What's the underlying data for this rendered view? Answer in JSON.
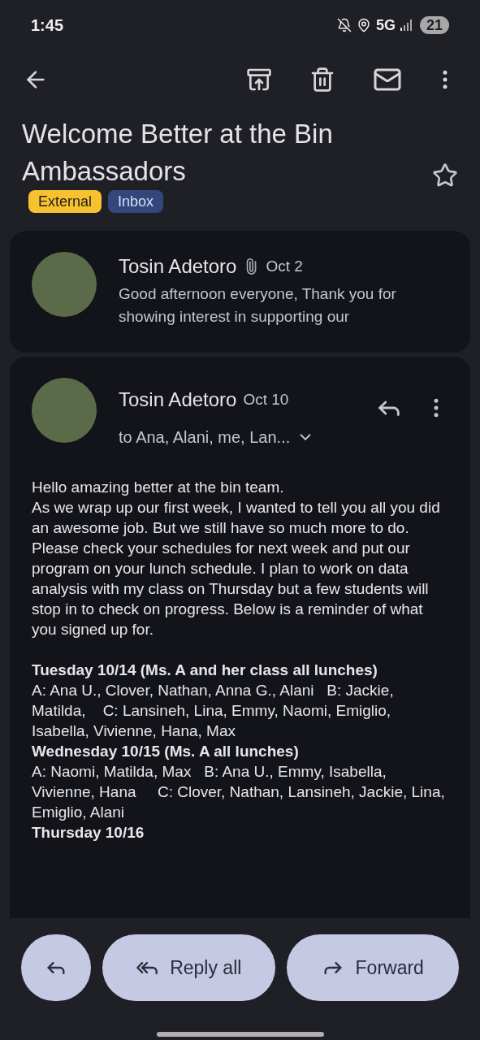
{
  "status_bar": {
    "time": "1:45",
    "network": "5G",
    "battery": "21"
  },
  "subject": {
    "title": "Welcome Better at the Bin Ambassadors",
    "labels": [
      {
        "text": "External",
        "color": "#f8c12f"
      },
      {
        "text": "Inbox",
        "color": "#34477c"
      }
    ],
    "starred": false
  },
  "messages": [
    {
      "sender": "Tosin Adetoro",
      "attachment": true,
      "date": "Oct 2",
      "snippet": "Good afternoon everyone, Thank you for showing interest in supporting our",
      "expanded": false
    },
    {
      "sender": "Tosin Adetoro",
      "attachment": false,
      "date": "Oct 10",
      "recipients": "to Ana, Alani, me, Lan...",
      "expanded": true,
      "body": [
        {
          "kind": "line",
          "text": "Hello amazing better at the bin team."
        },
        {
          "kind": "line",
          "text": "As we wrap up our first week, I wanted to tell you all you did an awesome job. But we still have so much more to do. Please check your schedules for next week and put our program on your lunch schedule. I plan to work on data analysis with my class on Thursday but a few students will stop in to check on progress. Below is a reminder of what you signed up for."
        },
        {
          "kind": "heading",
          "text": "Tuesday 10/14 (Ms. A and her class all lunches)"
        },
        {
          "kind": "line",
          "text": "A: Ana U., Clover, Nathan, Anna G., Alani   B: Jackie, Matilda,    C: Lansineh, Lina, Emmy, Naomi, Emiglio, Isabella, Vivienne, Hana, Max"
        },
        {
          "kind": "heading",
          "text": "Wednesday 10/15 (Ms. A  all lunches)"
        },
        {
          "kind": "line",
          "text": "A: Naomi, Matilda, Max   B: Ana U., Emmy, Isabella, Vivienne, Hana     C: Clover, Nathan, Lansineh, Jackie, Lina, Emiglio, Alani"
        },
        {
          "kind": "heading",
          "text": "Thursday 10/16"
        }
      ]
    }
  ],
  "actions": [
    {
      "kind": "reply"
    },
    {
      "kind": "reply_all",
      "label": "Reply all"
    },
    {
      "kind": "forward",
      "label": "Forward"
    }
  ]
}
